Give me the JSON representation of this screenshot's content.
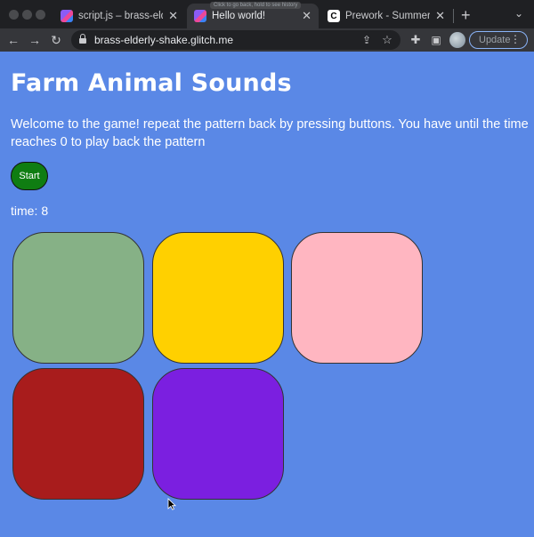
{
  "browser": {
    "tabs": [
      {
        "title": "script.js – brass-elderly-",
        "active": false
      },
      {
        "title": "Hello world!",
        "active": true
      },
      {
        "title": "Prework - Summer Inter",
        "active": false
      }
    ],
    "tooltip_hint": "Click to go back, hold to see history",
    "url": "brass-elderly-shake.glitch.me",
    "update_label": "Update"
  },
  "page": {
    "title": "Farm Animal Sounds",
    "instructions": "Welcome to the game! repeat the pattern back by pressing buttons. You have until the time reaches 0 to play back the pattern",
    "start_label": "Start",
    "timer_label": "time:",
    "timer_value": "8"
  },
  "pads": [
    {
      "id": 1,
      "color": "#86b186"
    },
    {
      "id": 2,
      "color": "#ffd000"
    },
    {
      "id": 3,
      "color": "#ffb6c1"
    },
    {
      "id": 4,
      "color": "#a81c1c"
    },
    {
      "id": 5,
      "color": "#7b1fe0"
    }
  ],
  "icons": {
    "back": "back-arrow-icon",
    "forward": "forward-arrow-icon",
    "reload": "reload-icon",
    "lock": "lock-icon",
    "share": "share-icon",
    "bookmark": "star-icon",
    "extensions": "puzzle-icon",
    "sidepanel": "side-panel-icon",
    "menu": "kebab-menu-icon"
  }
}
